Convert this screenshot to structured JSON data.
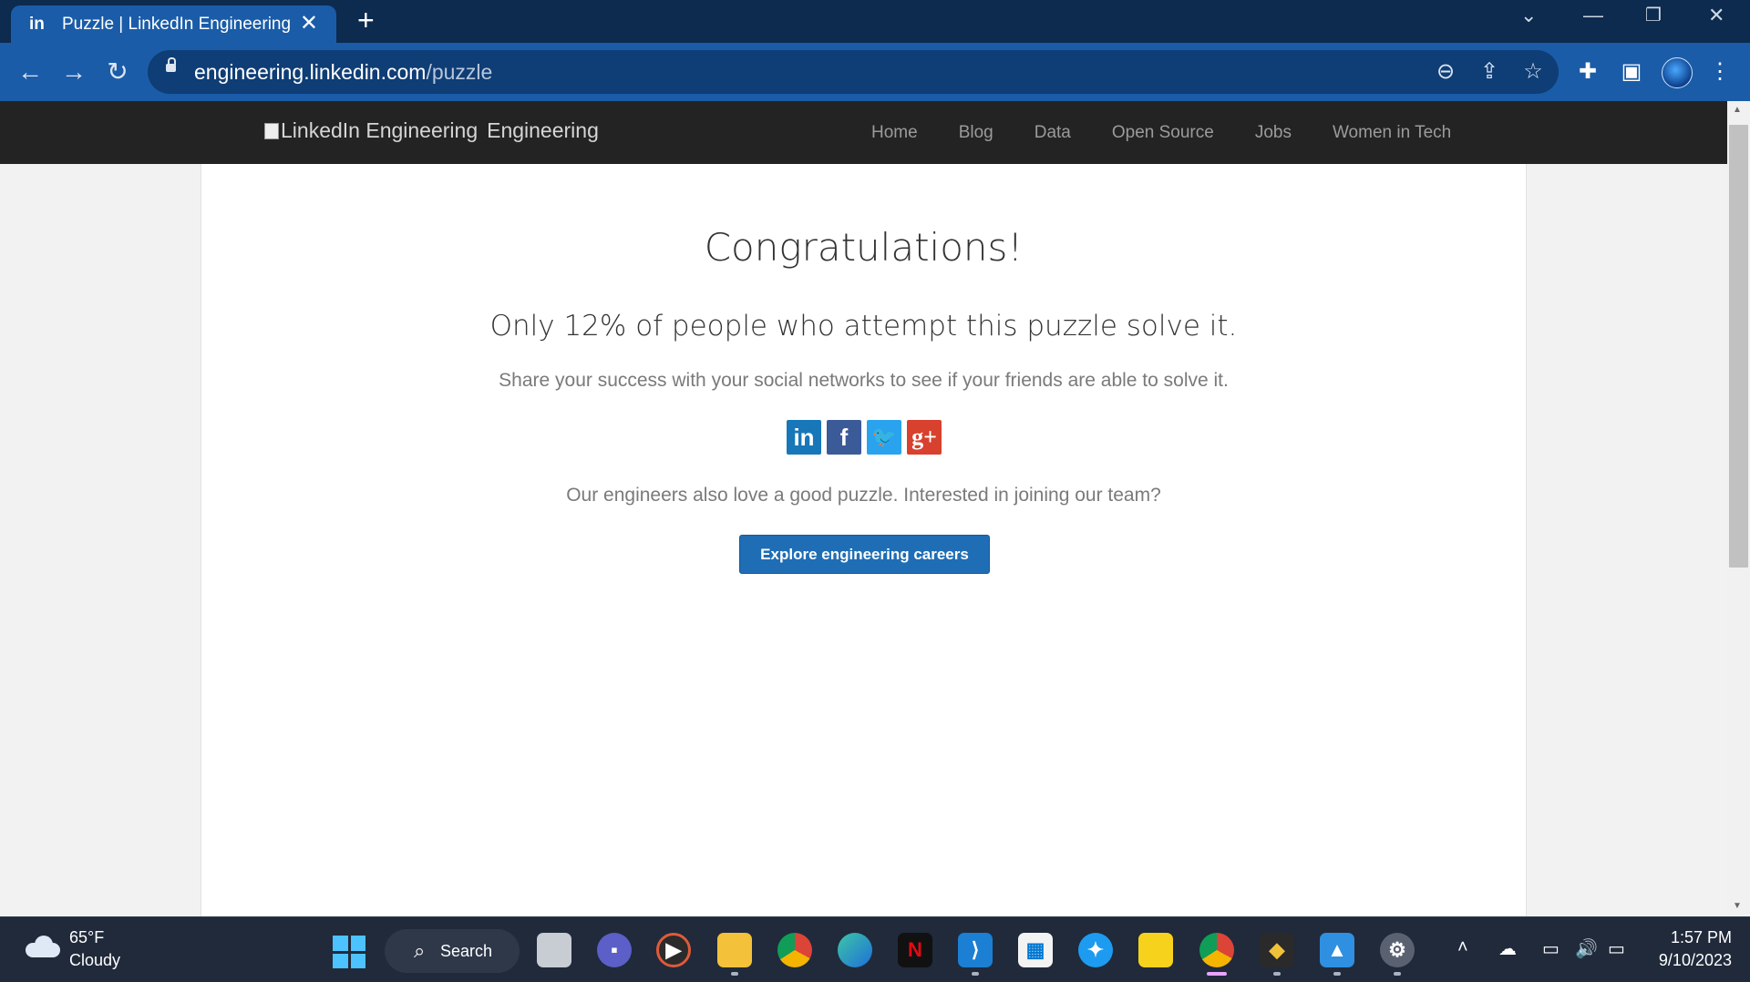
{
  "browser": {
    "tab_title": "Puzzle | LinkedIn Engineering",
    "tab_favicon": "in",
    "tab_close": "✕",
    "new_tab": "+",
    "url_host": "engineering.linkedin.com",
    "url_path": "/puzzle",
    "icons": [
      "back-arrow-icon",
      "forward-arrow-icon",
      "reload-icon",
      "lock-icon",
      "zoom-out-icon",
      "share-icon",
      "star-icon",
      "extensions-icon",
      "side-panel-icon",
      "profile-avatar",
      "more-menu-icon"
    ]
  },
  "site": {
    "logo_alt": "LinkedIn Engineering",
    "logo_text": "Engineering",
    "nav": [
      "Home",
      "Blog",
      "Data",
      "Open Source",
      "Jobs",
      "Women in Tech"
    ]
  },
  "main": {
    "headline": "Congratulations!",
    "subheadline": "Only 12% of people who attempt this puzzle solve it.",
    "share_text": "Share your success with your social networks to see if your friends are able to solve it.",
    "social": [
      {
        "name": "linkedin-share-icon",
        "glyph": "in",
        "color": "#1877b9"
      },
      {
        "name": "facebook-share-icon",
        "glyph": "f",
        "color": "#3b5a98"
      },
      {
        "name": "twitter-share-icon",
        "glyph": "🐦",
        "color": "#2aa3ef"
      },
      {
        "name": "googleplus-share-icon",
        "glyph": "g+",
        "color": "#d7412d"
      }
    ],
    "engineers_text": "Our engineers also love a good puzzle. Interested in joining our team?",
    "cta": "Explore engineering careers"
  },
  "taskbar": {
    "weather_temp": "65°F",
    "weather_cond": "Cloudy",
    "search_label": "Search",
    "time": "1:57 PM",
    "date": "9/10/2023"
  }
}
